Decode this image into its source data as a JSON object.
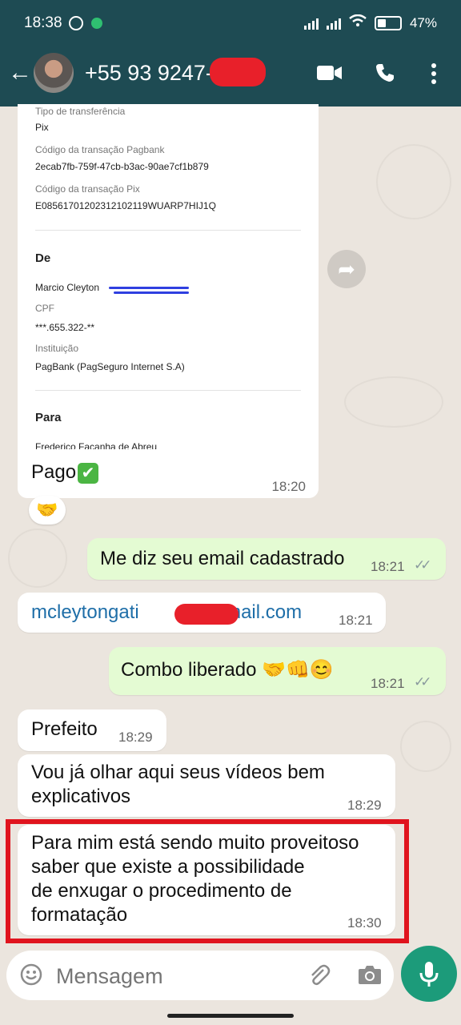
{
  "status": {
    "time": "18:38",
    "battery": "47%"
  },
  "header": {
    "contact": "+55 93 9247-8"
  },
  "receipt": {
    "tipo_label": "Tipo de transferência",
    "tipo_value": "Pix",
    "pagbank_label": "Código da transação Pagbank",
    "pagbank_value": "2ecab7fb-759f-47cb-b3ac-90ae7cf1b879",
    "pix_label": "Código da transação Pix",
    "pix_value": "E08561701202312102119WUARP7HIJ1Q",
    "de_heading": "De",
    "de_name": "Marcio Cleyton",
    "cpf_label": "CPF",
    "cpf_value": "***.655.322-**",
    "inst_label": "Instituição",
    "inst_value": "PagBank (PagSeguro Internet S.A)",
    "para_heading": "Para",
    "para_name": "Frederico Facanha de Abreu",
    "caption": "Pago",
    "time": "18:20"
  },
  "messages": [
    {
      "text": "Me diz seu email cadastrado",
      "time": "18:21"
    },
    {
      "text_a": "mcleytongati",
      "text_b": "gmail.com",
      "time": "18:21"
    },
    {
      "text": "Combo liberado 🤝👊😊",
      "time": "18:21"
    },
    {
      "text": "Prefeito",
      "time": "18:29"
    },
    {
      "text": "Vou já olhar aqui seus vídeos bem explicativos",
      "time": "18:29"
    },
    {
      "line1": "Para mim está sendo muito proveitoso",
      "line2": "saber que existe a possibilidade",
      "line3": "de enxugar o procedimento de",
      "line4": "formatação",
      "time": "18:30"
    }
  ],
  "composer": {
    "placeholder": "Mensagem"
  },
  "colors": {
    "header": "#1e4b53",
    "outgoing": "#e4fbd3",
    "accent": "#1c9b7a",
    "highlight": "#e0141e"
  }
}
